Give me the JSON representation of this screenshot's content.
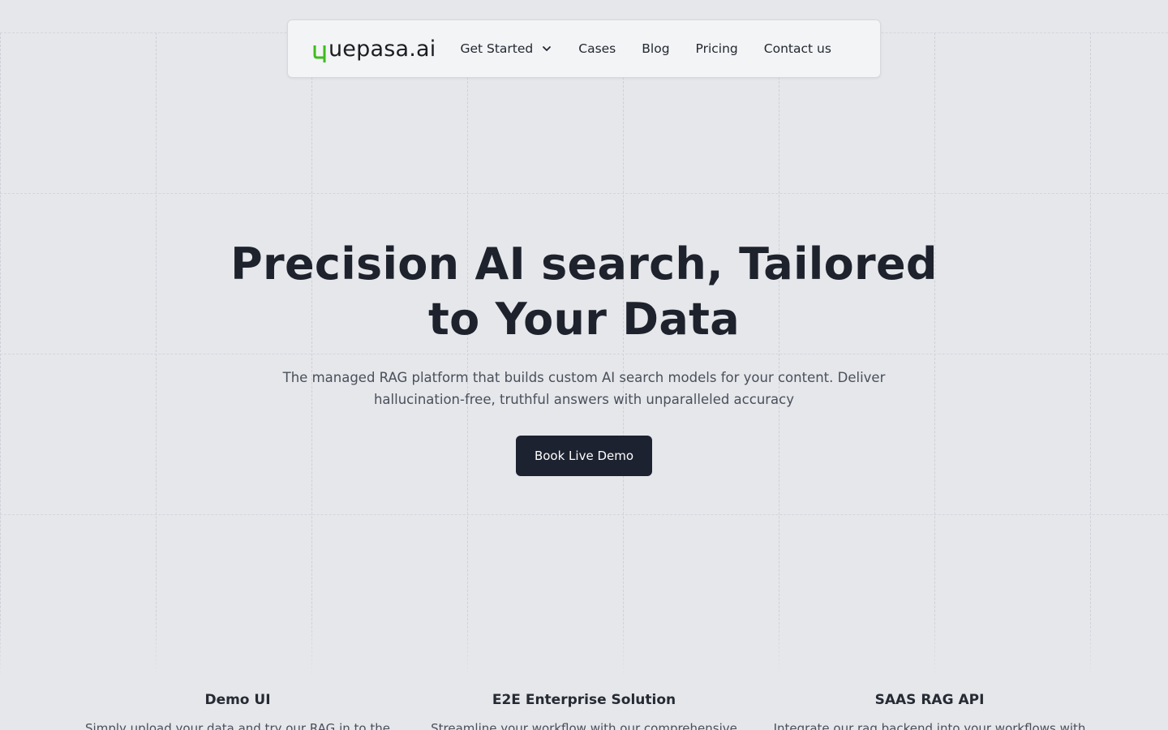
{
  "brand": {
    "logo_text": "uepasa.ai",
    "logo_accent_color": "#3dbb1f"
  },
  "nav": {
    "items": [
      {
        "label": "Get Started",
        "has_dropdown": true,
        "icon": "chevron-down-icon"
      },
      {
        "label": "Cases"
      },
      {
        "label": "Blog"
      },
      {
        "label": "Pricing"
      },
      {
        "label": "Contact us"
      }
    ]
  },
  "hero": {
    "title_line1": "Precision AI search, Tailored",
    "title_line2": "to Your Data",
    "subtitle": "The managed RAG platform that builds custom AI search models for your content. Deliver hallucination-free, truthful answers with unparalleled accuracy",
    "cta_label": "Book Live Demo"
  },
  "features": [
    {
      "title": "Demo UI",
      "desc": "Simply upload your data and try our RAG in to the"
    },
    {
      "title": "E2E Enterprise Solution",
      "desc": "Streamline your workflow with our comprehensive"
    },
    {
      "title": "SAAS RAG API",
      "desc": "Integrate our rag backend into your workflows with"
    }
  ],
  "colors": {
    "background": "#e5e7eb",
    "navbar_bg": "#f3f4f5",
    "primary_dark": "#1d2230",
    "text_dark": "#1e222c",
    "text_muted": "#4a4f5a"
  }
}
